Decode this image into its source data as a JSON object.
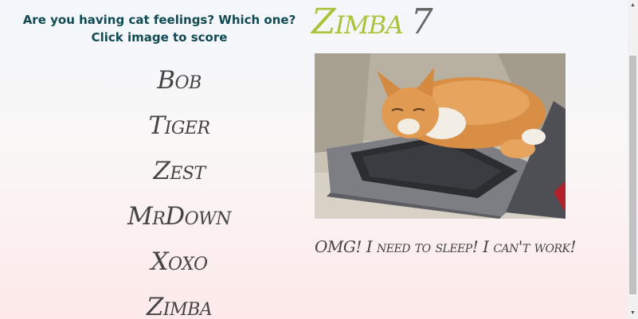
{
  "prompt": {
    "text": "Are you having cat feelings? Which one? Click image to score"
  },
  "header": {
    "cat_name": "Zimba",
    "score": "7"
  },
  "cats": [
    {
      "label": "Bob"
    },
    {
      "label": "Tiger"
    },
    {
      "label": "Zest"
    },
    {
      "label": "MrDown"
    },
    {
      "label": "Xoxo"
    },
    {
      "label": "Zimba"
    }
  ],
  "photo": {
    "alt": "Ginger cat sleeping on a laptop"
  },
  "caption": {
    "text": "OMG! I need to sleep! I can't work!"
  },
  "colors": {
    "accent": "#a9c43a",
    "prompt_text": "#114a52",
    "body_text": "#444444"
  },
  "icons": {
    "scroll_up": "triangle-up-icon",
    "scroll_down": "triangle-down-icon"
  }
}
